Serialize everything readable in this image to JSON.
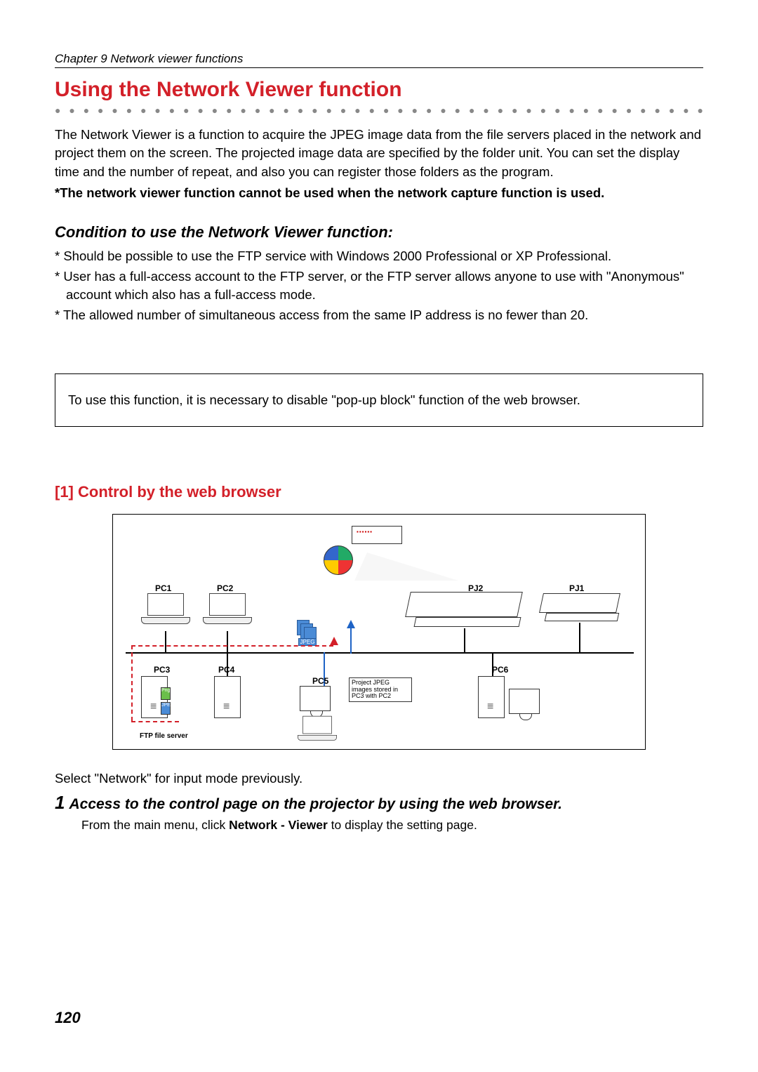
{
  "chapter": "Chapter 9 Network viewer functions",
  "title": "Using the Network Viewer function",
  "dots": "● ● ● ● ● ● ● ● ● ● ● ● ● ● ● ● ● ● ● ● ● ● ● ● ● ● ● ● ● ● ● ● ● ● ● ● ● ● ● ● ● ● ● ● ● ● ●",
  "intro": "The Network Viewer is a function to acquire the JPEG image data from the file servers placed in the network and project them on the screen. The projected image data are specified by the folder unit. You can set the display time and the number of repeat, and also you can register those folders as the program.",
  "intro_bold": "*The network viewer function cannot be used when the network capture function is used.",
  "cond_heading": "Condition to use the Network Viewer function:",
  "cond1": "* Should be possible to use the FTP service with Windows 2000 Professional or XP Professional.",
  "cond2": "* User has a full-access account to the FTP server, or the FTP server allows anyone to use with \"Anonymous\" account which also has a full-access mode.",
  "cond3": "* The allowed number of simultaneous access from the same IP address is no fewer than 20.",
  "notebox": "To use this function, it is necessary to disable \"pop-up block\" function of the web browser.",
  "section1": "[1] Control by the web browser",
  "diagram": {
    "pc1": "PC1",
    "pc2": "PC2",
    "pc3": "PC3",
    "pc4": "PC4",
    "pc5": "PC5",
    "pc6": "PC6",
    "pj1": "PJ1",
    "pj2": "PJ2",
    "jpeg": "JPEG",
    "ftp": "FTP file server",
    "callout": "Project JPEG images stored in PC3 with PC2"
  },
  "after_select": "Select \"Network\" for input mode previously.",
  "step_num": "1",
  "step_title": "Access to the control page on the projector by using the web browser.",
  "step_body_pre": "From the main menu, click ",
  "step_body_bold": "Network - Viewer",
  "step_body_post": " to display the setting page.",
  "page_number": "120"
}
